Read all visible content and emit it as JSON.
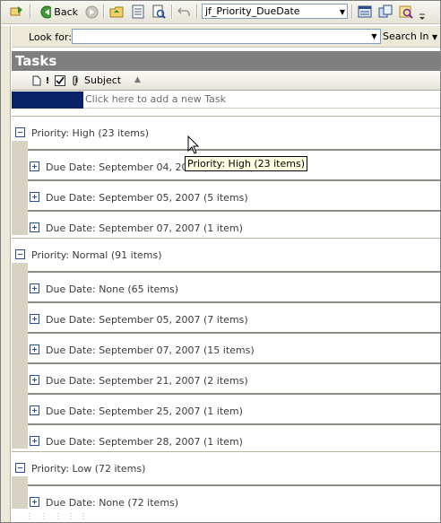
{
  "toolbar": {
    "back_label": "Back",
    "view_value": "jf_Priority_DueDate",
    "icons": [
      "send-receive-icon",
      "back-icon",
      "forward-icon",
      "up-folder-icon",
      "folder-list-icon",
      "print-preview-icon",
      "undo-icon",
      "reading-pane-icon",
      "categories-icon",
      "find-icon"
    ]
  },
  "search": {
    "look_for_label": "Look for:",
    "value": "",
    "search_in_label": "Search In"
  },
  "pane": {
    "title": "Tasks",
    "columns": {
      "subject": "Subject"
    },
    "new_task_placeholder": "Click here to add a new Task"
  },
  "groups": [
    {
      "label": "Priority: High (23 items)",
      "expanded": true,
      "subgroups": [
        "Due Date: September 04, 2007 (17 items)",
        "Due Date: September 05, 2007 (5 items)",
        "Due Date: September 07, 2007 (1 item)"
      ]
    },
    {
      "label": "Priority: Normal (91 items)",
      "expanded": true,
      "subgroups": [
        "Due Date: None (65 items)",
        "Due Date: September 05, 2007 (7 items)",
        "Due Date: September 07, 2007 (15 items)",
        "Due Date: September 21, 2007 (2 items)",
        "Due Date: September 25, 2007 (1 item)",
        "Due Date: September 28, 2007 (1 item)"
      ]
    },
    {
      "label": "Priority: Low (72 items)",
      "expanded": true,
      "subgroups": [
        "Due Date: None (72 items)"
      ]
    }
  ],
  "tooltip": "Priority: High (23 items)",
  "colors": {
    "title_bar": "#7f7f7f",
    "selection": "#0a246a",
    "tooltip_bg": "#ffffe1",
    "group_text": "#3b3b3b"
  }
}
